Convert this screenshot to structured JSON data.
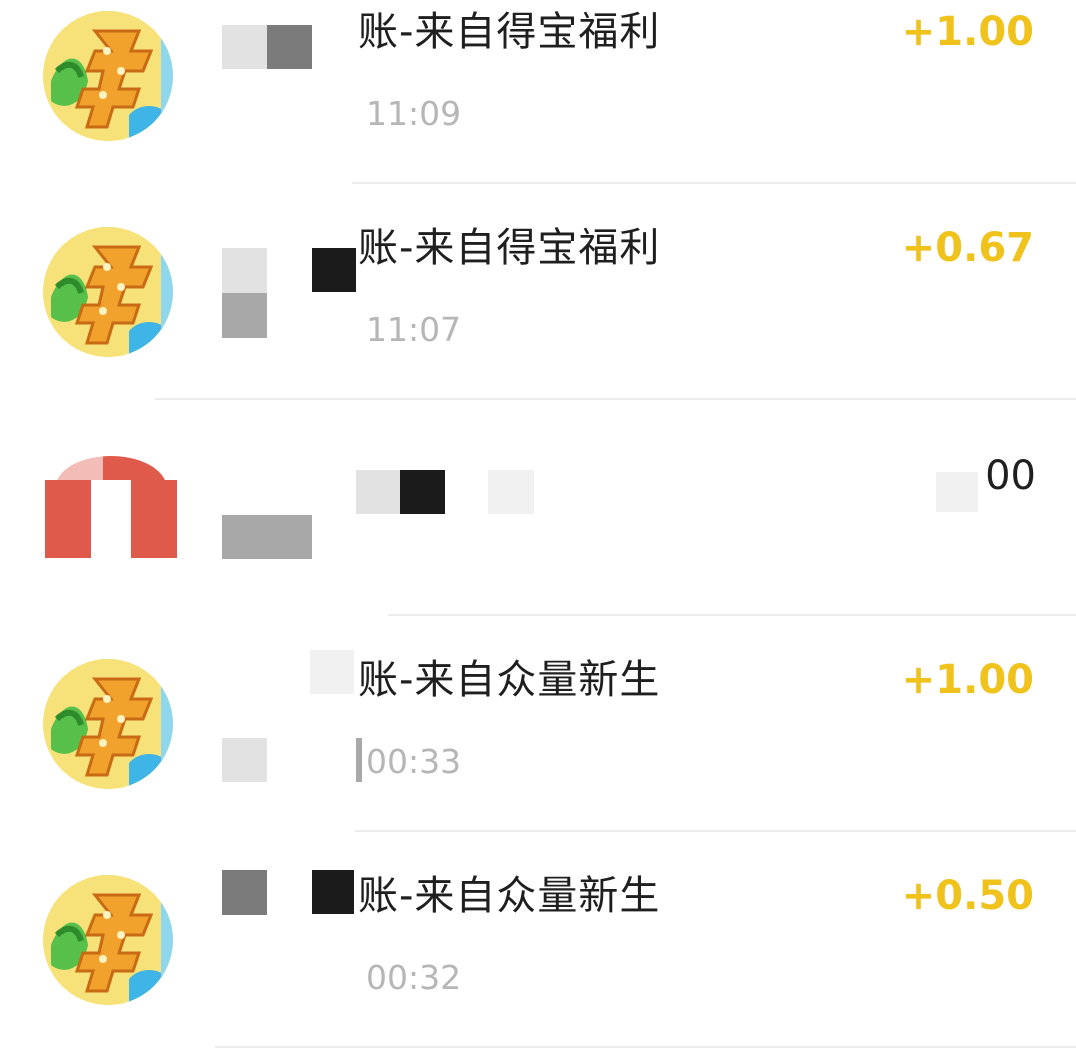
{
  "transactions": [
    {
      "title": "账-来自得宝福利",
      "time": "11:09",
      "amount": "+1.00"
    },
    {
      "title": "账-来自得宝福利",
      "time": "11:07",
      "amount": "+0.67"
    },
    {
      "title": "",
      "time": "",
      "amount": "00"
    },
    {
      "title": "账-来自众量新生",
      "time": "00:33",
      "amount": "+1.00"
    },
    {
      "title": "账-来自众量新生",
      "time": "00:32",
      "amount": "+0.50"
    }
  ],
  "colors": {
    "amount_positive": "#f0c21c",
    "divider": "#ececec",
    "avatar_background": "#f7e27a",
    "logo_red": "#e05a4c"
  },
  "icons": {
    "rows_avatar": "yuan-coin-avatar-icon",
    "row_2_avatar": "red-logo-icon"
  }
}
